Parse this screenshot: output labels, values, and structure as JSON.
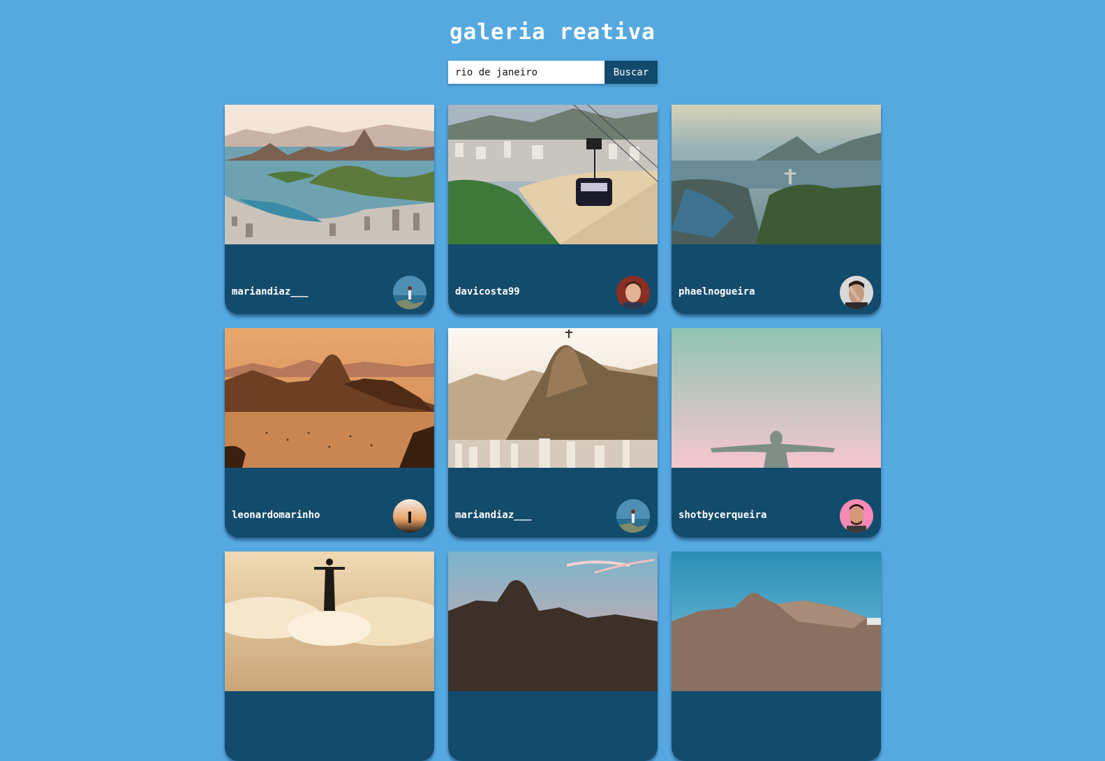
{
  "header": {
    "title": "galeria reativa"
  },
  "search": {
    "value": "rio de janeiro",
    "button_label": "Buscar"
  },
  "cards": [
    {
      "user": "mariandiaz___",
      "photo": "sugarloaf-bay-aerial",
      "avatar": "person-on-rock-avatar"
    },
    {
      "user": "davicosta99",
      "photo": "cable-car-beach",
      "avatar": "man-portrait-avatar"
    },
    {
      "user": "phaelnogueira",
      "photo": "christ-redeemer-mountains",
      "avatar": "man-covering-face-avatar"
    },
    {
      "user": "leonardomarinho",
      "photo": "sugarloaf-sunset",
      "avatar": "person-sunset-avatar"
    },
    {
      "user": "mariandiaz___",
      "photo": "corcovado-city-morning",
      "avatar": "person-on-rock-avatar"
    },
    {
      "user": "shotbycerqueira",
      "photo": "christ-statue-pastel-sky",
      "avatar": "man-pink-background-avatar"
    },
    {
      "user": "",
      "photo": "christ-statue-clouds",
      "avatar": ""
    },
    {
      "user": "",
      "photo": "sugarloaf-pink-sky",
      "avatar": ""
    },
    {
      "user": "",
      "photo": "sugarloaf-blue-sky",
      "avatar": ""
    }
  ]
}
